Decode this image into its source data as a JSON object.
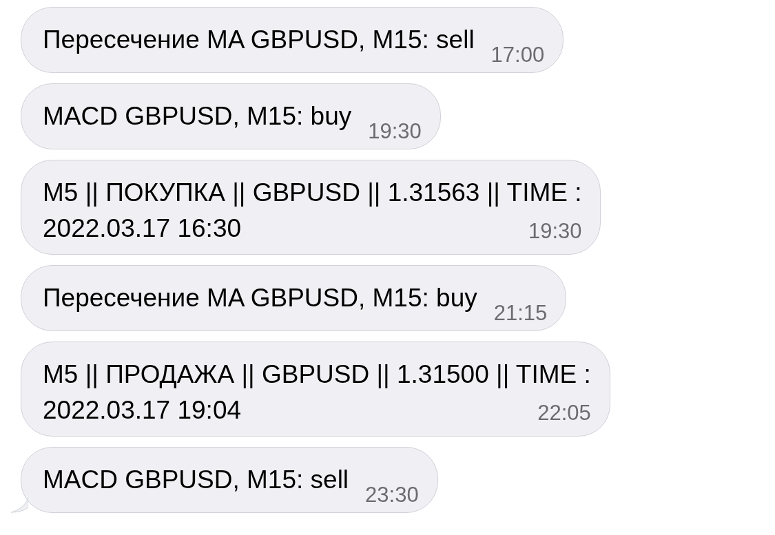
{
  "messages": [
    {
      "lines": [
        "Пересечение MA GBPUSD, M15: sell"
      ],
      "time": "17:00",
      "tail": false
    },
    {
      "lines": [
        "MACD GBPUSD, M15: buy"
      ],
      "time": "19:30",
      "tail": false
    },
    {
      "lines": [
        "M5 || ПОКУПКА || GBPUSD || 1.31563 || TIME :",
        "2022.03.17 16:30"
      ],
      "time": "19:30",
      "tail": false
    },
    {
      "lines": [
        "Пересечение MA GBPUSD, M15: buy"
      ],
      "time": "21:15",
      "tail": false
    },
    {
      "lines": [
        "M5 || ПРОДАЖА || GBPUSD || 1.31500 || TIME :",
        "2022.03.17 19:04"
      ],
      "time": "22:05",
      "tail": false
    },
    {
      "lines": [
        "MACD GBPUSD, M15: sell"
      ],
      "time": "23:30",
      "tail": true
    }
  ]
}
